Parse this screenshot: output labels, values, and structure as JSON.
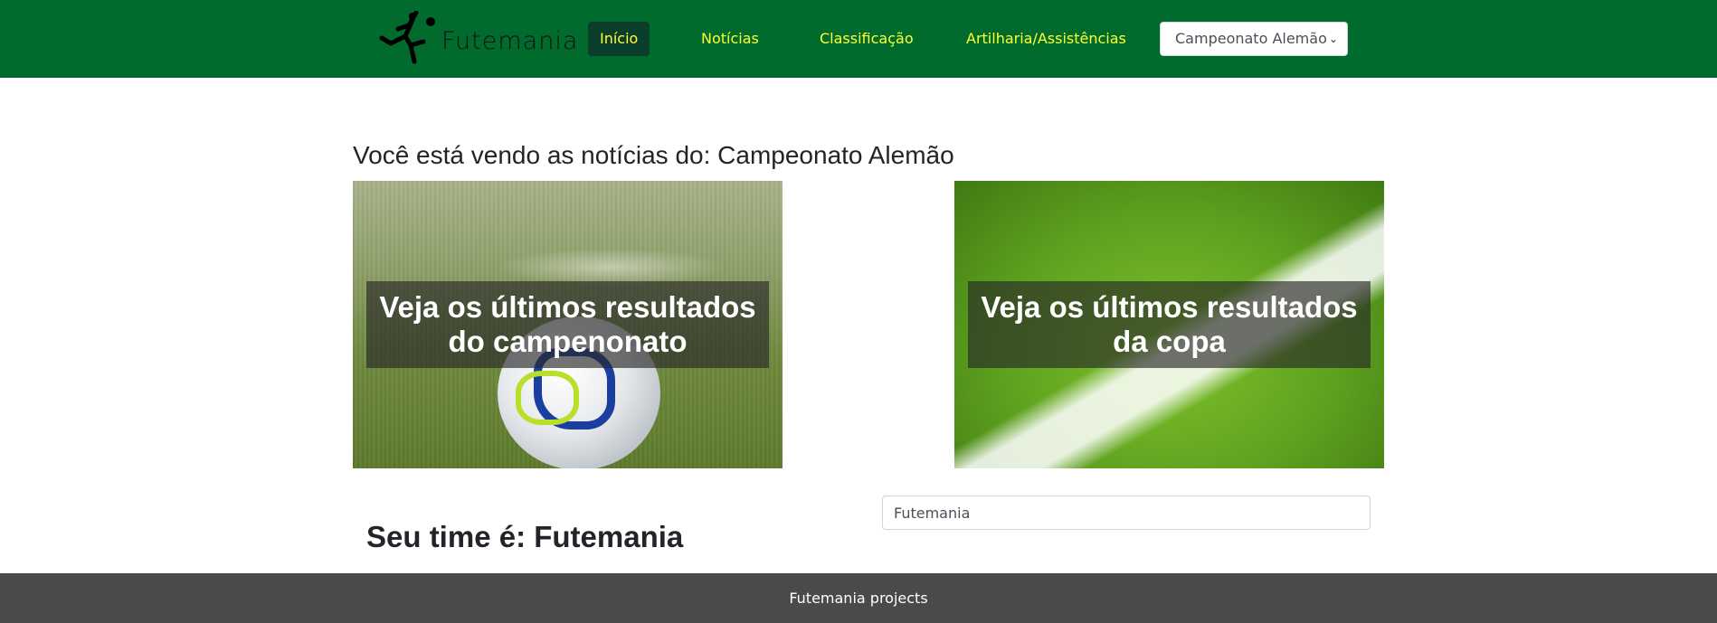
{
  "brand": {
    "name": "Futemania",
    "logo_icon": "bicycle-kick-player-icon"
  },
  "nav": {
    "items": [
      {
        "label": "Início",
        "active": true
      },
      {
        "label": "Notícias",
        "active": false
      },
      {
        "label": "Classificação",
        "active": false
      },
      {
        "label": "Artilharia/Assistências",
        "active": false
      }
    ],
    "championship_select": {
      "selected": "Campeonato Alemão",
      "icon": "chevron-down-icon"
    }
  },
  "main": {
    "heading": "Você está vendo as notícias do: Campeonato Alemão",
    "cards": [
      {
        "title": "Veja os últimos resultados do campenonato"
      },
      {
        "title": "Veja os últimos resultados da copa"
      }
    ],
    "team": {
      "label": "Seu time é: Futemania",
      "input_value": "Futemania"
    }
  },
  "footer": {
    "text": "Futemania projects"
  },
  "colors": {
    "navbar_bg": "#006b2d",
    "nav_link": "#ffff33",
    "nav_active_bg": "#0a3d2a",
    "footer_bg": "#4a4a4a"
  }
}
